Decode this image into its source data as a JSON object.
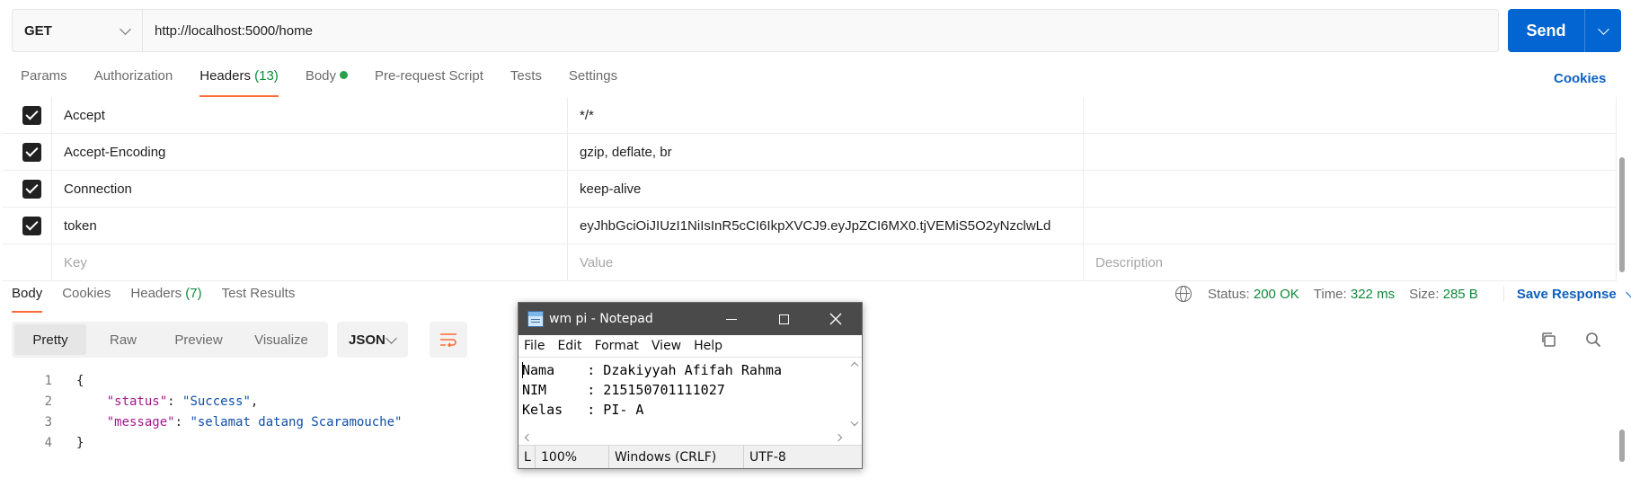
{
  "request": {
    "method": "GET",
    "url": "http://localhost:5000/home",
    "send_label": "Send"
  },
  "request_tabs": [
    {
      "label": "Params"
    },
    {
      "label": "Authorization"
    },
    {
      "label": "Headers",
      "count": "(13)"
    },
    {
      "label": "Body"
    },
    {
      "label": "Pre-request Script"
    },
    {
      "label": "Tests"
    },
    {
      "label": "Settings"
    }
  ],
  "cookies_link": "Cookies",
  "headers": [
    {
      "key": "Accept",
      "value": "*/*",
      "enabled": true
    },
    {
      "key": "Accept-Encoding",
      "value": "gzip, deflate, br",
      "enabled": true
    },
    {
      "key": "Connection",
      "value": "keep-alive",
      "enabled": true
    },
    {
      "key": "token",
      "value": "eyJhbGciOiJIUzI1NiIsInR5cCI6IkpXVCJ9.eyJpZCI6MX0.tjVEMiS5O2yNzclwLd",
      "enabled": true
    }
  ],
  "headers_placeholder": {
    "key": "Key",
    "value": "Value",
    "description": "Description"
  },
  "response_tabs": [
    {
      "label": "Body"
    },
    {
      "label": "Cookies"
    },
    {
      "label": "Headers",
      "count": "(7)"
    },
    {
      "label": "Test Results"
    }
  ],
  "status": {
    "status_label": "Status:",
    "status_value": "200 OK",
    "time_label": "Time:",
    "time_value": "322 ms",
    "size_label": "Size:",
    "size_value": "285 B",
    "save_response": "Save Response"
  },
  "view_modes": [
    "Pretty",
    "Raw",
    "Preview",
    "Visualize"
  ],
  "format": "JSON",
  "response_code": {
    "line_numbers": [
      "1",
      "2",
      "3",
      "4"
    ],
    "open_brace": "{",
    "close_brace": "}",
    "fields": [
      {
        "key": "\"status\"",
        "value": "\"Success\"",
        "trail": ","
      },
      {
        "key": "\"message\"",
        "value": "\"selamat datang Scaramouche\"",
        "trail": ""
      }
    ]
  },
  "notepad": {
    "title": "wm pi - Notepad",
    "menu": [
      "File",
      "Edit",
      "Format",
      "View",
      "Help"
    ],
    "lines": [
      "Nama    : Dzakiyyah Afifah Rahma",
      "NIM     : 215150701111027",
      "Kelas   : PI- A"
    ],
    "status": [
      "L",
      "100%",
      "Windows (CRLF)",
      "UTF-8"
    ]
  },
  "colors": {
    "accent": "#ff6c37",
    "send": "#0265d2",
    "status_ok": "#0f8a3a",
    "link": "#0d5fc1"
  }
}
